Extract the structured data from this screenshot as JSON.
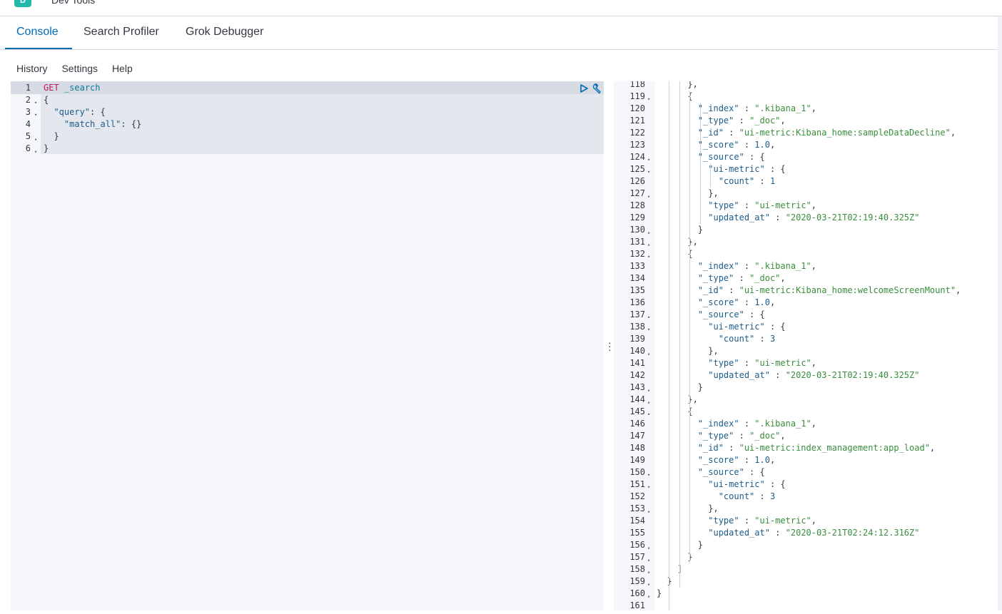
{
  "app": {
    "logo_letter": "D",
    "title": "Dev Tools"
  },
  "tabs": [
    {
      "label": "Console",
      "active": true
    },
    {
      "label": "Search Profiler",
      "active": false
    },
    {
      "label": "Grok Debugger",
      "active": false
    }
  ],
  "menu": {
    "history": "History",
    "settings": "Settings",
    "help": "Help"
  },
  "editor": {
    "lines": [
      {
        "num": "1",
        "fold": "",
        "text": "GET _search"
      },
      {
        "num": "2",
        "fold": "▾",
        "text": "{"
      },
      {
        "num": "3",
        "fold": "▾",
        "text": "  \"query\": {"
      },
      {
        "num": "4",
        "fold": "",
        "text": "    \"match_all\": {}"
      },
      {
        "num": "5",
        "fold": "▴",
        "text": "  }"
      },
      {
        "num": "6",
        "fold": "▴",
        "text": "}"
      }
    ]
  },
  "output": {
    "first_line": 118,
    "lines": [
      {
        "num": "118",
        "fold": "",
        "text": "      },"
      },
      {
        "num": "119",
        "fold": "▾",
        "text": "      {"
      },
      {
        "num": "120",
        "fold": "",
        "text": "        \"_index\" : \".kibana_1\","
      },
      {
        "num": "121",
        "fold": "",
        "text": "        \"_type\" : \"_doc\","
      },
      {
        "num": "122",
        "fold": "",
        "text": "        \"_id\" : \"ui-metric:Kibana_home:sampleDataDecline\","
      },
      {
        "num": "123",
        "fold": "",
        "text": "        \"_score\" : 1.0,"
      },
      {
        "num": "124",
        "fold": "▾",
        "text": "        \"_source\" : {"
      },
      {
        "num": "125",
        "fold": "▾",
        "text": "          \"ui-metric\" : {"
      },
      {
        "num": "126",
        "fold": "",
        "text": "            \"count\" : 1"
      },
      {
        "num": "127",
        "fold": "▴",
        "text": "          },"
      },
      {
        "num": "128",
        "fold": "",
        "text": "          \"type\" : \"ui-metric\","
      },
      {
        "num": "129",
        "fold": "",
        "text": "          \"updated_at\" : \"2020-03-21T02:19:40.325Z\""
      },
      {
        "num": "130",
        "fold": "▴",
        "text": "        }"
      },
      {
        "num": "131",
        "fold": "▴",
        "text": "      },"
      },
      {
        "num": "132",
        "fold": "▾",
        "text": "      {"
      },
      {
        "num": "133",
        "fold": "",
        "text": "        \"_index\" : \".kibana_1\","
      },
      {
        "num": "134",
        "fold": "",
        "text": "        \"_type\" : \"_doc\","
      },
      {
        "num": "135",
        "fold": "",
        "text": "        \"_id\" : \"ui-metric:Kibana_home:welcomeScreenMount\","
      },
      {
        "num": "136",
        "fold": "",
        "text": "        \"_score\" : 1.0,"
      },
      {
        "num": "137",
        "fold": "▾",
        "text": "        \"_source\" : {"
      },
      {
        "num": "138",
        "fold": "▾",
        "text": "          \"ui-metric\" : {"
      },
      {
        "num": "139",
        "fold": "",
        "text": "            \"count\" : 3"
      },
      {
        "num": "140",
        "fold": "▴",
        "text": "          },"
      },
      {
        "num": "141",
        "fold": "",
        "text": "          \"type\" : \"ui-metric\","
      },
      {
        "num": "142",
        "fold": "",
        "text": "          \"updated_at\" : \"2020-03-21T02:19:40.325Z\""
      },
      {
        "num": "143",
        "fold": "▴",
        "text": "        }"
      },
      {
        "num": "144",
        "fold": "▴",
        "text": "      },"
      },
      {
        "num": "145",
        "fold": "▾",
        "text": "      {"
      },
      {
        "num": "146",
        "fold": "",
        "text": "        \"_index\" : \".kibana_1\","
      },
      {
        "num": "147",
        "fold": "",
        "text": "        \"_type\" : \"_doc\","
      },
      {
        "num": "148",
        "fold": "",
        "text": "        \"_id\" : \"ui-metric:index_management:app_load\","
      },
      {
        "num": "149",
        "fold": "",
        "text": "        \"_score\" : 1.0,"
      },
      {
        "num": "150",
        "fold": "▾",
        "text": "        \"_source\" : {"
      },
      {
        "num": "151",
        "fold": "▾",
        "text": "          \"ui-metric\" : {"
      },
      {
        "num": "152",
        "fold": "",
        "text": "            \"count\" : 3"
      },
      {
        "num": "153",
        "fold": "▴",
        "text": "          },"
      },
      {
        "num": "154",
        "fold": "",
        "text": "          \"type\" : \"ui-metric\","
      },
      {
        "num": "155",
        "fold": "",
        "text": "          \"updated_at\" : \"2020-03-21T02:24:12.316Z\""
      },
      {
        "num": "156",
        "fold": "▴",
        "text": "        }"
      },
      {
        "num": "157",
        "fold": "▴",
        "text": "      }"
      },
      {
        "num": "158",
        "fold": "▴",
        "text": "    ]"
      },
      {
        "num": "159",
        "fold": "▴",
        "text": "  }"
      },
      {
        "num": "160",
        "fold": "▴",
        "text": "}"
      },
      {
        "num": "161",
        "fold": "",
        "text": ""
      }
    ]
  },
  "colors": {
    "accent": "#006bb4",
    "logo": "#24b9a9",
    "json_value": "#388e3c",
    "json_key": "#1d5c8a",
    "http_verb": "#c2185b"
  }
}
